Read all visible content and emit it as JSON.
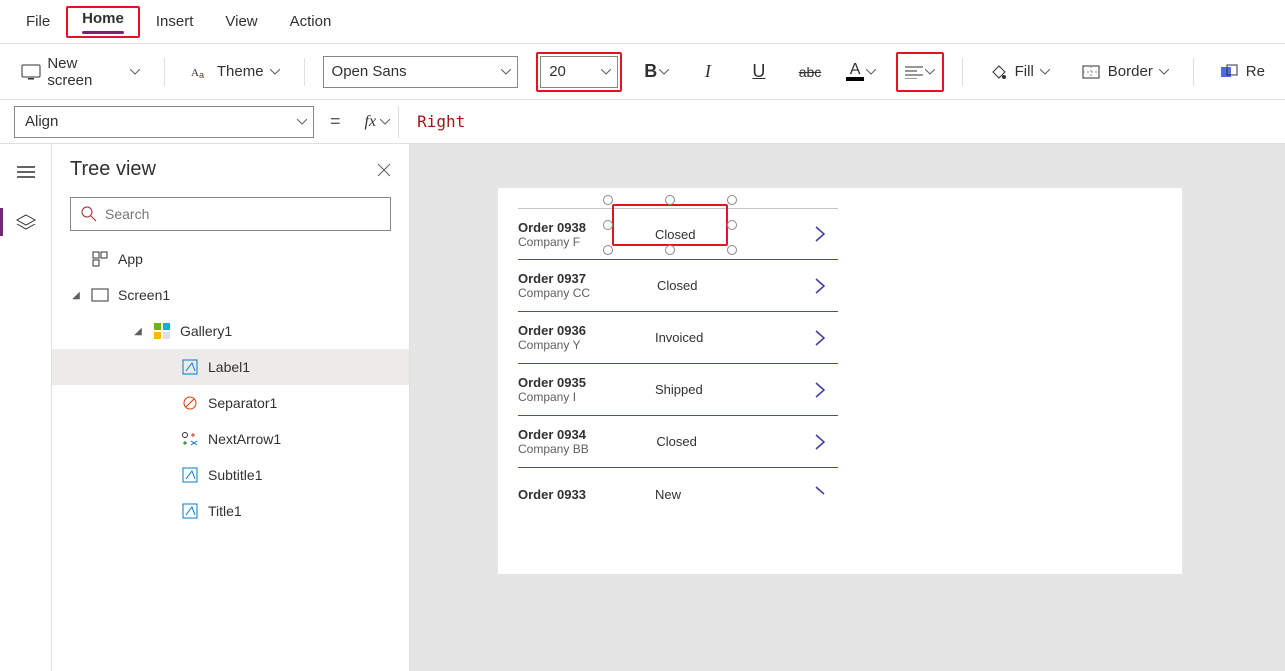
{
  "menu": {
    "file": "File",
    "home": "Home",
    "insert": "Insert",
    "view": "View",
    "action": "Action"
  },
  "ribbon": {
    "new_screen": "New screen",
    "theme": "Theme",
    "font_name": "Open Sans",
    "font_size": "20",
    "fill": "Fill",
    "border": "Border",
    "reorder_prefix": "Re"
  },
  "formula": {
    "property": "Align",
    "fx": "fx",
    "value": "Right"
  },
  "tree": {
    "title": "Tree view",
    "search_placeholder": "Search",
    "app": "App",
    "screen": "Screen1",
    "gallery": "Gallery1",
    "label": "Label1",
    "separator": "Separator1",
    "nextarrow": "NextArrow1",
    "subtitle": "Subtitle1",
    "title_item": "Title1"
  },
  "gallery_rows": [
    {
      "title": "Order 0938",
      "sub": "Company F",
      "status": "Closed"
    },
    {
      "title": "Order 0937",
      "sub": "Company CC",
      "status": "Closed"
    },
    {
      "title": "Order 0936",
      "sub": "Company Y",
      "status": "Invoiced"
    },
    {
      "title": "Order 0935",
      "sub": "Company I",
      "status": "Shipped"
    },
    {
      "title": "Order 0934",
      "sub": "Company BB",
      "status": "Closed"
    },
    {
      "title": "Order 0933",
      "sub": "",
      "status": "New"
    }
  ]
}
